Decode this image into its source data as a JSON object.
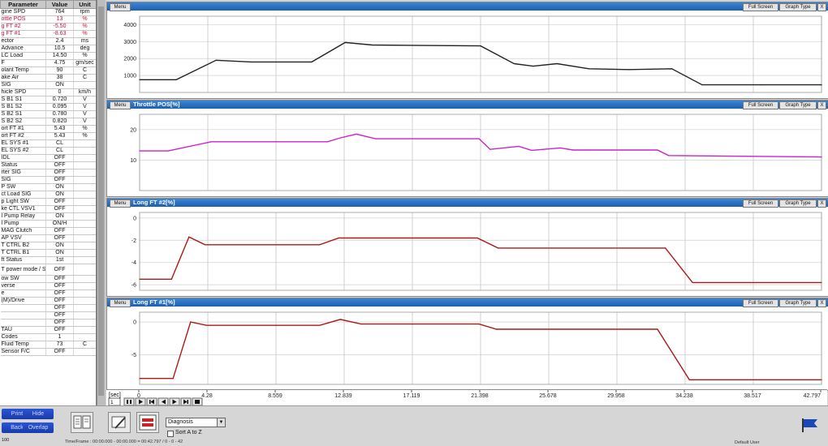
{
  "table": {
    "headers": [
      "Parameter",
      "Value",
      "Unit"
    ],
    "rows": [
      {
        "p": "gine SPD",
        "v": "764",
        "u": "rpm",
        "hl": false
      },
      {
        "p": "ottle POS",
        "v": "13",
        "u": "%",
        "hl": true
      },
      {
        "p": "g FT #2",
        "v": "-5.50",
        "u": "%",
        "hl": true
      },
      {
        "p": "g FT #1",
        "v": "-8.63",
        "u": "%",
        "hl": true
      },
      {
        "p": "ector",
        "v": "2.4",
        "u": "ms",
        "hl": false
      },
      {
        "p": "Advance",
        "v": "10.5",
        "u": "deg",
        "hl": false
      },
      {
        "p": "LC Load",
        "v": "14.50",
        "u": "%",
        "hl": false
      },
      {
        "p": "F",
        "v": "4.75",
        "u": "gm/sec",
        "hl": false
      },
      {
        "p": "olant Temp",
        "v": "90",
        "u": "C",
        "hl": false
      },
      {
        "p": "ake Air",
        "v": "38",
        "u": "C",
        "hl": false
      },
      {
        "p": "SIG",
        "v": "ON",
        "u": "",
        "hl": false
      },
      {
        "p": "hicle SPD",
        "v": "0",
        "u": "km/h",
        "hl": false
      },
      {
        "p": "S B1 S1",
        "v": "0.720",
        "u": "V",
        "hl": false
      },
      {
        "p": "S B1 S2",
        "v": "0.095",
        "u": "V",
        "hl": false
      },
      {
        "p": "S B2 S1",
        "v": "0.780",
        "u": "V",
        "hl": false
      },
      {
        "p": "S B2 S2",
        "v": "0.820",
        "u": "V",
        "hl": false
      },
      {
        "p": "ort FT #1",
        "v": "5.43",
        "u": "%",
        "hl": false
      },
      {
        "p": "ort FT #2",
        "v": "5.43",
        "u": "%",
        "hl": false
      },
      {
        "p": "EL SYS #1",
        "v": "CL",
        "u": "",
        "hl": false
      },
      {
        "p": "EL SYS #2",
        "v": "CL",
        "u": "",
        "hl": false
      },
      {
        "p": "IDL",
        "v": "OFF",
        "u": "",
        "hl": false
      },
      {
        "p": "Status",
        "v": "OFF",
        "u": "",
        "hl": false
      },
      {
        "p": "rter SIG",
        "v": "OFF",
        "u": "",
        "hl": false
      },
      {
        "p": "SIG",
        "v": "OFF",
        "u": "",
        "hl": false
      },
      {
        "p": "P SW",
        "v": "ON",
        "u": "",
        "hl": false
      },
      {
        "p": "ct Load SIG",
        "v": "ON",
        "u": "",
        "hl": false
      },
      {
        "p": "p Light SW",
        "v": "OFF",
        "u": "",
        "hl": false
      },
      {
        "p": "ke CTL VSV1",
        "v": "OFF",
        "u": "",
        "hl": false
      },
      {
        "p": "l Pump Relay",
        "v": "ON",
        "u": "",
        "hl": false
      },
      {
        "p": "l Pump",
        "v": "ON/H",
        "u": "",
        "hl": false
      },
      {
        "p": "MAG Clutch",
        "v": "OFF",
        "u": "",
        "hl": false
      },
      {
        "p": "AP VSV",
        "v": "OFF",
        "u": "",
        "hl": false
      },
      {
        "p": "T CTRL B2",
        "v": "ON",
        "u": "",
        "hl": false
      },
      {
        "p": "T CTRL B1",
        "v": "ON",
        "u": "",
        "hl": false
      },
      {
        "p": "ft Status",
        "v": "1st",
        "u": "",
        "hl": false
      },
      {
        "p": "T power mode / SW",
        "v": "OFF",
        "u": "",
        "hl": false
      },
      {
        "p": "ow SW",
        "v": "OFF",
        "u": "",
        "hl": false
      },
      {
        "p": "verse",
        "v": "OFF",
        "u": "",
        "hl": false
      },
      {
        "p": "e",
        "v": "OFF",
        "u": "",
        "hl": false
      },
      {
        "p": "(M)/Drive",
        "v": "OFF",
        "u": "",
        "hl": false
      },
      {
        "p": "",
        "v": "OFF",
        "u": "",
        "hl": false
      },
      {
        "p": "",
        "v": "OFF",
        "u": "",
        "hl": false
      },
      {
        "p": "",
        "v": "OFF",
        "u": "",
        "hl": false
      },
      {
        "p": "TAU",
        "v": "OFF",
        "u": "",
        "hl": false
      },
      {
        "p": "Codes",
        "v": "1",
        "u": "",
        "hl": false
      },
      {
        "p": "Fluid Temp",
        "v": "73",
        "u": "C",
        "hl": false
      },
      {
        "p": "Sensor F/C",
        "v": "OFF",
        "u": "",
        "hl": false
      }
    ]
  },
  "panel_buttons": {
    "menu": "Menu",
    "full_screen": "Full Screen",
    "graph_type": "Graph Type",
    "close": "X"
  },
  "chart_data": [
    {
      "type": "line",
      "title": "",
      "ylabel": "",
      "color": "#222222",
      "ylim": [
        0,
        4500
      ],
      "yticks": [
        1000,
        2000,
        3000,
        4000
      ],
      "x": [
        0,
        2.3,
        4.8,
        7,
        10.8,
        12.9,
        14.6,
        21.4,
        23.5,
        24.7,
        26.2,
        28.2,
        30.7,
        33.4,
        35.3,
        39,
        42.8
      ],
      "values": [
        750,
        750,
        1900,
        1800,
        1800,
        2950,
        2800,
        2750,
        1700,
        1550,
        1700,
        1400,
        1350,
        1400,
        450,
        450,
        450
      ]
    },
    {
      "type": "line",
      "title": "Throttle POS[%]",
      "ylabel": "",
      "color": "#cc22cc",
      "ylim": [
        0,
        25
      ],
      "yticks": [
        10,
        20
      ],
      "x": [
        0,
        1.8,
        4.5,
        11.8,
        12.6,
        13.6,
        14.8,
        21.3,
        22,
        23.8,
        24.6,
        26.4,
        27.2,
        28.2,
        32.5,
        33.2,
        42.8
      ],
      "values": [
        13,
        13,
        16,
        16,
        17.3,
        18.5,
        17,
        17,
        13.5,
        14.5,
        13.2,
        14,
        13.3,
        13.3,
        13.3,
        11.5,
        11
      ]
    },
    {
      "type": "line",
      "title": "Long FT #2[%]",
      "ylabel": "",
      "color": "#b01818",
      "ylim": [
        -6.5,
        0.5
      ],
      "yticks": [
        -6,
        -4,
        -2,
        0
      ],
      "x": [
        0,
        2,
        3.1,
        4.1,
        11.3,
        12.5,
        21.2,
        22.5,
        33,
        34.7,
        42.8
      ],
      "values": [
        -5.5,
        -5.5,
        -1.7,
        -2.4,
        -2.4,
        -1.8,
        -1.8,
        -2.7,
        -2.7,
        -5.8,
        -5.8
      ]
    },
    {
      "type": "line",
      "title": "Long FT #1[%]",
      "ylabel": "",
      "color": "#b01818",
      "ylim": [
        -9.5,
        1.5
      ],
      "yticks": [
        -5,
        0
      ],
      "x": [
        0,
        2.1,
        3.2,
        4.2,
        11.3,
        12.6,
        13.9,
        21.3,
        22.4,
        32.5,
        34.5,
        42.8
      ],
      "values": [
        -8.6,
        -8.6,
        0,
        -0.5,
        -0.5,
        0.4,
        -0.3,
        -0.3,
        -1.1,
        -1.1,
        -8.8,
        -8.8
      ]
    }
  ],
  "xaxis": {
    "unit": "[sec]",
    "min": 0,
    "max": 42.797,
    "ticks": [
      "0",
      "4.28",
      "8.559",
      "12.839",
      "17.119",
      "21.398",
      "25.678",
      "29.958",
      "34.238",
      "38.517",
      "42.797"
    ]
  },
  "playback": {
    "page": "1"
  },
  "bottom": {
    "buttons": {
      "print": "Print",
      "hide": "Hide",
      "back": "Back",
      "overlap": "Overlap"
    },
    "mode_select": "Diagnosis",
    "sort_label": "Sort A to Z",
    "status_left": "100",
    "time_frame": "Time/Frame : 00:00.000 - 00:00.000 = 00:42.797 / 0 - 0 - 42",
    "user": "Default User"
  }
}
